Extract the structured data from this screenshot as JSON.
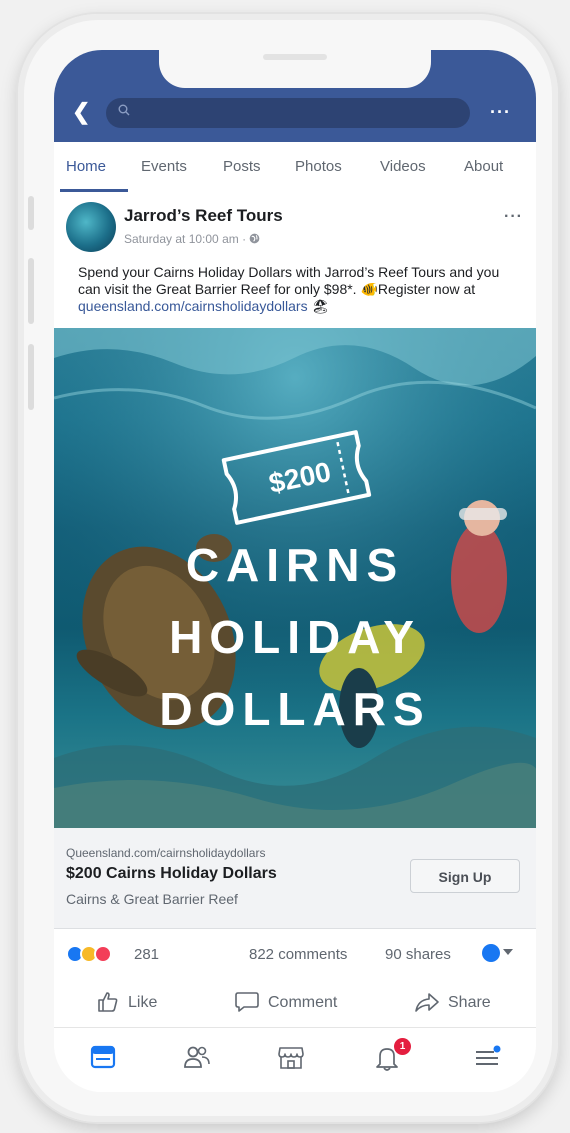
{
  "search": {
    "placeholder": ""
  },
  "tabs": [
    {
      "label": "Home",
      "active": true
    },
    {
      "label": "Events"
    },
    {
      "label": "Posts"
    },
    {
      "label": "Photos"
    },
    {
      "label": "Videos"
    },
    {
      "label": "About"
    }
  ],
  "post": {
    "page_name": "Jarrod’s Reef Tours",
    "time": "Saturday at 10:00 am · ",
    "text_before_link": "Spend your Cairns Holiday Dollars with Jarrod’s Reef Tours and you can visit the Great Barrier Reef for only $98*. 🐠Register now at ",
    "link": "queensland.com/cairnsholidaydollars",
    "text_after_link": " 🏖"
  },
  "image": {
    "ticket_amount": "$200",
    "headline_line1": "CAIRNS",
    "headline_line2": "HOLIDAY",
    "headline_line3": "DOLLARS"
  },
  "link_card": {
    "domain": "Queensland.com/cairnsholidaydollars",
    "title": "$200 Cairns Holiday Dollars",
    "subtitle": "Cairns & Great Barrier Reef",
    "button_label": "Sign Up"
  },
  "stats": {
    "reactions": "281",
    "comments": "822 comments",
    "shares": "90 shares"
  },
  "actions": {
    "like": "Like",
    "comment": "Comment",
    "share": "Share"
  },
  "bottom_nav": {
    "notification_badge": "1"
  },
  "colors": {
    "brand": "#3b5998",
    "link": "#385898",
    "badge": "#e41e3f"
  }
}
